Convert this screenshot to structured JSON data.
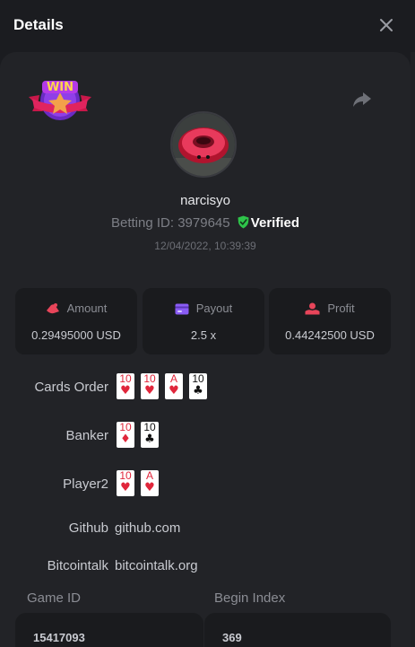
{
  "modal": {
    "title": "Details"
  },
  "user": {
    "name": "narcisyo",
    "betting_id_label": "Betting ID:",
    "betting_id": "3979645",
    "verified_label": "Verified",
    "timestamp": "12/04/2022, 10:39:39"
  },
  "badge": {
    "text": "WIN"
  },
  "stats": [
    {
      "label": "Amount",
      "value": "0.29495000 USD",
      "icon": "amount-icon",
      "icon_color": "#e8455a"
    },
    {
      "label": "Payout",
      "value": "2.5 x",
      "icon": "wallet-icon",
      "icon_color": "#8a5cf5"
    },
    {
      "label": "Profit",
      "value": "0.44242500 USD",
      "icon": "profit-icon",
      "icon_color": "#e8455a"
    }
  ],
  "rows": {
    "cards_order_label": "Cards Order",
    "banker_label": "Banker",
    "player2_label": "Player2",
    "github_label": "Github",
    "github_value": "github.com",
    "bitcointalk_label": "Bitcointalk",
    "bitcointalk_value": "bitcointalk.org"
  },
  "hands": {
    "cards_order": [
      {
        "rank": "10",
        "suit": "♥",
        "color": "red"
      },
      {
        "rank": "10",
        "suit": "♥",
        "color": "red"
      },
      {
        "rank": "A",
        "suit": "♥",
        "color": "red"
      },
      {
        "rank": "10",
        "suit": "♣",
        "color": "black"
      }
    ],
    "banker": [
      {
        "rank": "10",
        "suit": "♦",
        "color": "red"
      },
      {
        "rank": "10",
        "suit": "♣",
        "color": "black"
      }
    ],
    "player2": [
      {
        "rank": "10",
        "suit": "♥",
        "color": "red"
      },
      {
        "rank": "A",
        "suit": "♥",
        "color": "red"
      }
    ]
  },
  "fields": {
    "game_id_label": "Game ID",
    "game_id": "15417093",
    "begin_index_label": "Begin Index",
    "begin_index": "369"
  },
  "colors": {
    "background": "#1b1c20",
    "panel": "#222327",
    "card_bg": "#1a1b1e",
    "verified_green": "#2ec44a"
  }
}
